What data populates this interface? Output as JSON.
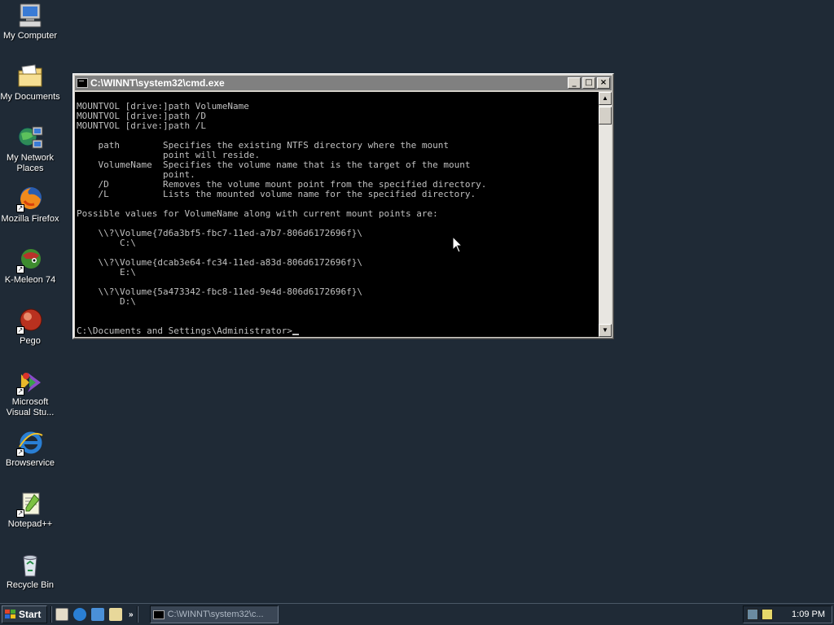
{
  "desktop": {
    "icons": [
      {
        "label": "My Computer"
      },
      {
        "label": "My Documents"
      },
      {
        "label": "My Network Places"
      },
      {
        "label": "Mozilla Firefox"
      },
      {
        "label": "K-Meleon 74"
      },
      {
        "label": "Pego"
      },
      {
        "label": "Microsoft Visual Stu..."
      },
      {
        "label": "Browservice"
      },
      {
        "label": "Notepad++"
      },
      {
        "label": "Recycle Bin"
      }
    ]
  },
  "window": {
    "title": "C:\\WINNT\\system32\\cmd.exe",
    "buttons": {
      "minimize": "_",
      "maximize": "□",
      "close": "×"
    },
    "console_lines": [
      "MOUNTVOL [drive:]path VolumeName",
      "MOUNTVOL [drive:]path /D",
      "MOUNTVOL [drive:]path /L",
      "",
      "    path        Specifies the existing NTFS directory where the mount",
      "                point will reside.",
      "    VolumeName  Specifies the volume name that is the target of the mount",
      "                point.",
      "    /D          Removes the volume mount point from the specified directory.",
      "    /L          Lists the mounted volume name for the specified directory.",
      "",
      "Possible values for VolumeName along with current mount points are:",
      "",
      "    \\\\?\\Volume{7d6a3bf5-fbc7-11ed-a7b7-806d6172696f}\\",
      "        C:\\",
      "",
      "    \\\\?\\Volume{dcab3e64-fc34-11ed-a83d-806d6172696f}\\",
      "        E:\\",
      "",
      "    \\\\?\\Volume{5a473342-fbc8-11ed-9e4d-806d6172696f}\\",
      "        D:\\",
      "",
      ""
    ],
    "prompt": "C:\\Documents and Settings\\Administrator>"
  },
  "taskbar": {
    "start_label": "Start",
    "quicklaunch_more": "»",
    "task_label": "C:\\WINNT\\system32\\c...",
    "clock": "1:09 PM"
  },
  "colors": {
    "desktop": "#1f2a36",
    "console_bg": "#000000",
    "console_text": "#c0c0c0",
    "titlebar_inactive": "#808080"
  }
}
